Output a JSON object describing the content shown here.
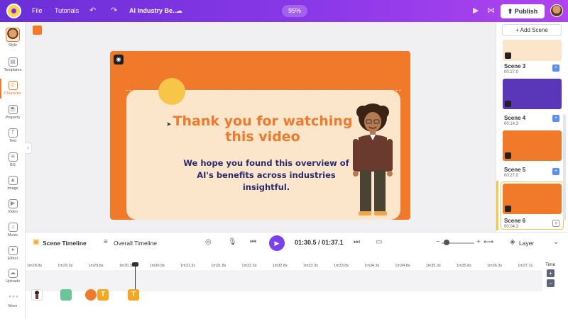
{
  "topbar": {
    "menu_file": "File",
    "menu_tutorials": "Tutorials",
    "project_title": "AI Industry Be...",
    "zoom": "95%",
    "publish_label": "Publish"
  },
  "sidebar": {
    "items": [
      {
        "label": "Style"
      },
      {
        "label": "Templates"
      },
      {
        "label": "Character"
      },
      {
        "label": "Property"
      },
      {
        "label": "Text"
      },
      {
        "label": "BG"
      },
      {
        "label": "Image"
      },
      {
        "label": "Video"
      },
      {
        "label": "Music"
      },
      {
        "label": "Effect"
      },
      {
        "label": "Uploads"
      },
      {
        "label": "More"
      }
    ]
  },
  "canvas": {
    "heading": "Thank you for watching this video",
    "subtext": "We hope you found this overview of AI's benefits across industries insightful."
  },
  "scenes": {
    "add_label": "+ Add Scene",
    "items": [
      {
        "name": "Scene 3",
        "duration": "00:27.0"
      },
      {
        "name": "Scene 4",
        "duration": "00:14.3"
      },
      {
        "name": "Scene 5",
        "duration": "00:27.0"
      },
      {
        "name": "Scene 6",
        "duration": "00:04.3"
      }
    ]
  },
  "timeline": {
    "scene_timeline": "Scene Timeline",
    "overall_timeline": "Overall Timeline",
    "current_time": "01:30.5",
    "separator": "/",
    "total_time": "01:37.1",
    "layer_label": "Layer",
    "time_label": "Time",
    "ticks": [
      "1m28.8s",
      "1m29.3s",
      "1m29.8s",
      "1m30.3s",
      "1m30.8s",
      "1m31.3s",
      "1m31.8s",
      "1m32.3s",
      "1m32.8s",
      "1m33.3s",
      "1m33.8s",
      "1m34.3s",
      "1m34.8s",
      "1m35.3s",
      "1m35.8s",
      "1m36.3s",
      "1m37.1s"
    ]
  },
  "colors": {
    "accent": "#7b3ff0",
    "scene_bg": "#f07a2a",
    "cream": "#fbe6cc",
    "heading": "#ee7a2d",
    "subtext": "#2d2a6e"
  }
}
